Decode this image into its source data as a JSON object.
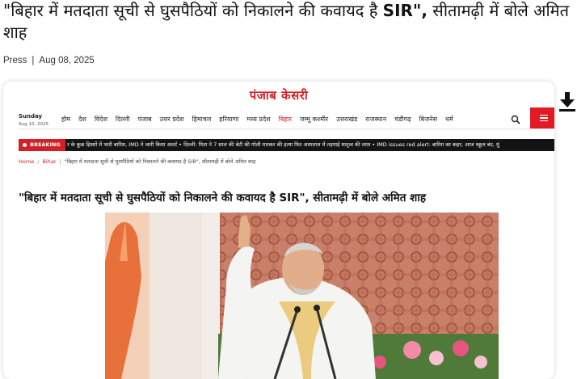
{
  "headline": {
    "part1": "\"बिहार में मतदाता सूची से घुसपैठियों को निकालने की कवायद है ",
    "bold": "SIR\",",
    "part2": " सीतामढ़ी में बोले अमित शाह"
  },
  "meta": {
    "source": "Press",
    "separator": "|",
    "date": "Aug 08, 2025"
  },
  "site": {
    "logo": "पंजाब केसरी",
    "day": "Sunday",
    "date": "Aug 10, 2025",
    "nav": [
      "होम",
      "देश",
      "विदेश",
      "दिल्ली",
      "पंजाब",
      "उत्तर प्रदेश",
      "हिमाचल",
      "हरियाणा",
      "मध्य प्रदेश",
      "बिहार",
      "जम्मू कश्मीर",
      "उत्तराखंड",
      "राजस्थान",
      "चंडीगढ़",
      "बिजनेस",
      "धर्म"
    ],
    "active_nav": "बिहार",
    "breaking_label": "BREAKING",
    "ticker": "र के कुछ हिस्सों में भारी बारिश, IMD ने जारी किया अलर्ट   •  दिल्ली: पिता ने 7 साल की बेटी की गोली मारकर की हत्या फिर अस्पताल में तड़पाई मातृत्व की लाश   •  IMD issues red alert: बारिश का कहर, आज स्कूल बंद, मुं",
    "breadcrumb": {
      "home": "Home",
      "section": "Bihar",
      "current": "\"बिहार में मतदाता सूची से घुसपैठियों को निकालने की कवायद है SIR\", सीतामढ़ी में बोले अमित शाह"
    },
    "article_title": "\"बिहार में मतदाता सूची से घुसपैठियों को निकालने की कवायद है SIR\", सीतामढ़ी में बोले अमित शाह"
  },
  "colors": {
    "brand_red": "#d31f26",
    "ticker_bg": "#141414"
  },
  "icons": {
    "search": "search-icon",
    "menu": "hamburger-menu-icon",
    "download": "download-icon"
  }
}
